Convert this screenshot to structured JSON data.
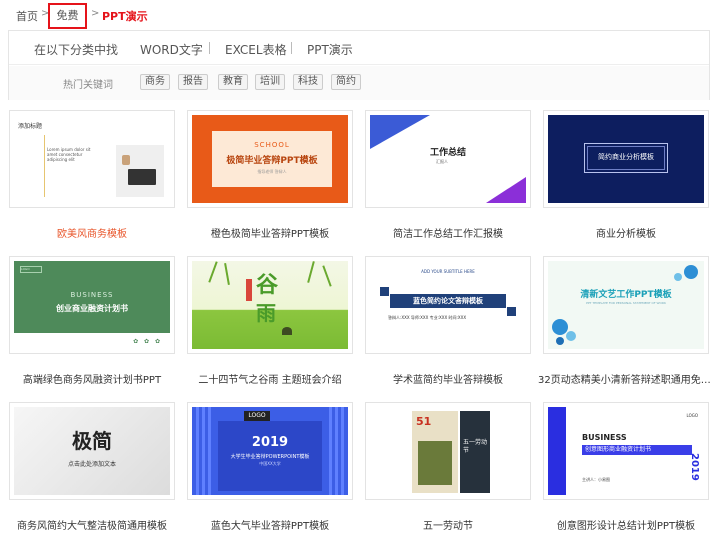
{
  "breadcrumb": {
    "home": "首页",
    "free": "免费",
    "current": "PPT演示",
    "separator": ">"
  },
  "filter": {
    "category_label": "在以下分类中找",
    "types": [
      "WORD文字",
      "EXCEL表格",
      "PPT演示"
    ],
    "hot_label": "热门关键词",
    "tags": [
      "商务",
      "报告",
      "教育",
      "培训",
      "科技",
      "简约"
    ]
  },
  "templates": [
    {
      "caption": "欧美风商务模板",
      "highlight": true
    },
    {
      "caption": "橙色极简毕业答辩PPT模板"
    },
    {
      "caption": "简洁工作总结工作汇报模"
    },
    {
      "caption": "商业分析模板"
    },
    {
      "caption": "高端绿色商务风融资计划书PPT"
    },
    {
      "caption": "二十四节气之谷雨 主题班会介绍"
    },
    {
      "caption": "学术蓝简约毕业答辩模板"
    },
    {
      "caption": "32页动态精美小清新答辩述职通用免费..."
    },
    {
      "caption": "商务风简约大气整洁极简通用模板"
    },
    {
      "caption": "蓝色大气毕业答辩PPT模板"
    },
    {
      "caption": "五一劳动节"
    },
    {
      "caption": "创意图形设计总结计划PPT模板"
    }
  ],
  "thumbs": {
    "t1": {
      "heading": "添加标题",
      "body": "Lorem ipsum dolor sit amet consectetur adipiscing elit"
    },
    "t2": {
      "tag": "SCHOOL",
      "title": "极简毕业答辩PPT模板",
      "sub": "指导老师 答辩人"
    },
    "t3": {
      "title": "工作总结",
      "sub": "汇报人"
    },
    "t4": {
      "title": "简约商业分析模板"
    },
    "t5": {
      "logo": "LOGO",
      "en": "BUSINESS",
      "title": "创业商业融资计划书"
    },
    "t6": {
      "c1": "谷",
      "c2": "雨"
    },
    "t7": {
      "en": "ADD YOUR SUBTITLE HERE",
      "title": "蓝色简约论文答辩模板",
      "info": "答辩人:XXX  导师:XXX  专业:XXX  时间:XXX"
    },
    "t8": {
      "title": "清新文艺工作PPT模板",
      "sub": "PPT TEMPLATE FOR PERSONAL STATEMENT OF WORK"
    },
    "t9": {
      "title": "极简",
      "sub": "点击此处添加文本"
    },
    "t10": {
      "logo": "LOGO",
      "year": "2019",
      "title": "大学生毕业答辩POWERPOINT模板",
      "sub": "中国XX大学"
    },
    "t11": {
      "num": "51",
      "title": "五一劳动节"
    },
    "t12": {
      "logo": "LOGO",
      "en": "BUSINESS",
      "title": "创意图形商业融资计划书",
      "year": "2019",
      "info": "主讲人：小易图"
    }
  },
  "colors": {
    "accent_red": "#e5131a",
    "caption_highlight": "#e8552a"
  }
}
